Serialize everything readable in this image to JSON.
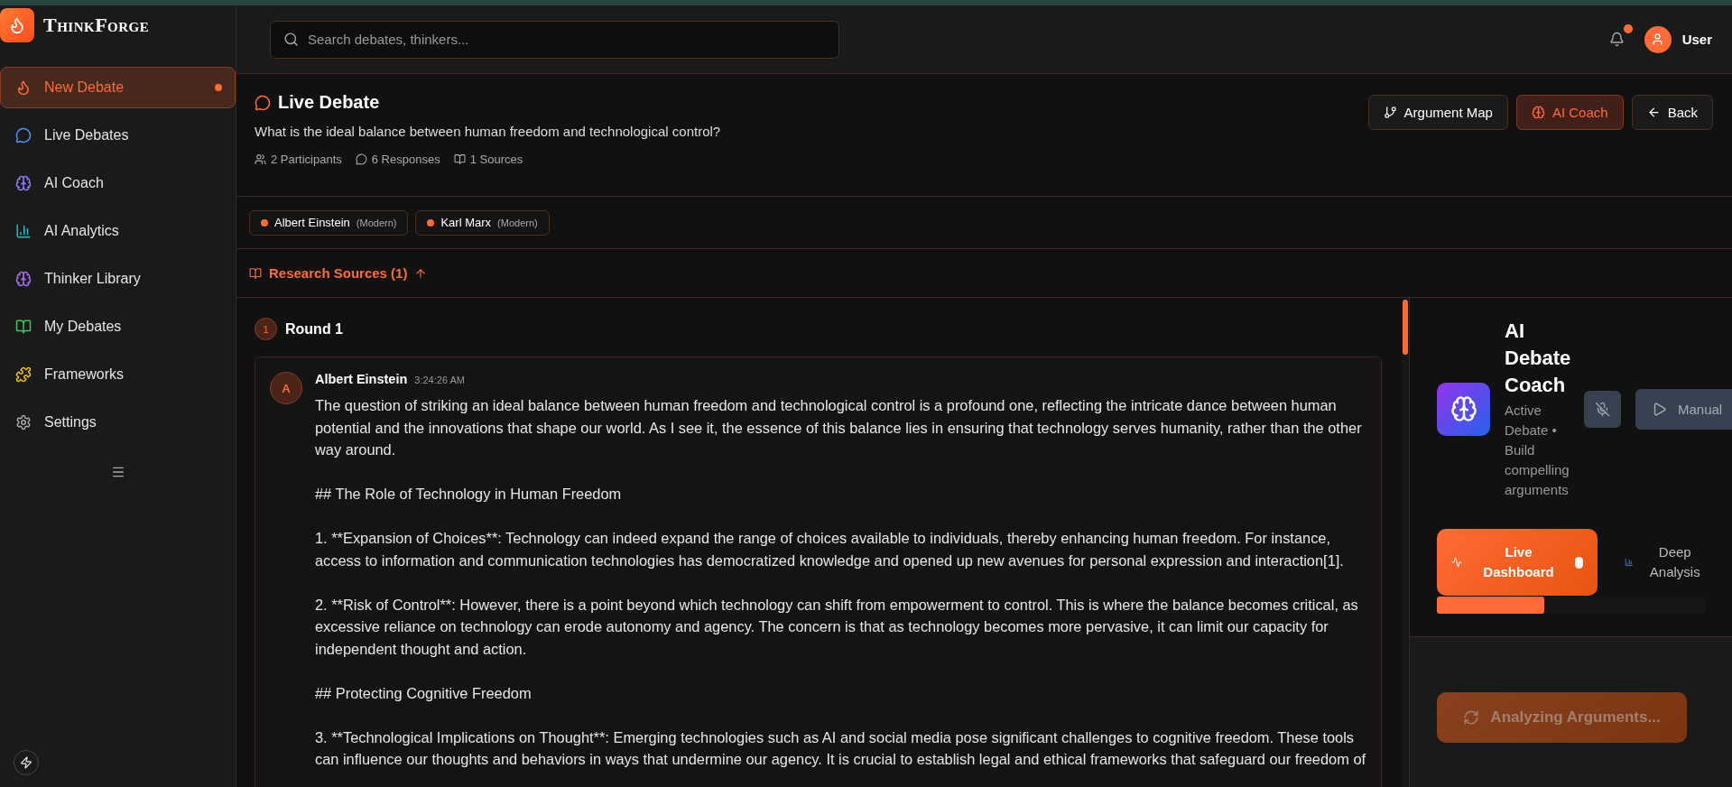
{
  "app": {
    "name": "ThinkForge"
  },
  "sidebar": {
    "items": [
      {
        "label": "New Debate",
        "selected": true,
        "dot": true
      },
      {
        "label": "Live Debates",
        "selected": false,
        "dot": false
      },
      {
        "label": "AI Coach",
        "selected": false,
        "dot": false
      },
      {
        "label": "AI Analytics",
        "selected": false,
        "dot": false
      },
      {
        "label": "Thinker Library",
        "selected": false,
        "dot": false
      },
      {
        "label": "My Debates",
        "selected": false,
        "dot": false
      },
      {
        "label": "Frameworks",
        "selected": false,
        "dot": false
      },
      {
        "label": "Settings",
        "selected": false,
        "dot": false
      }
    ]
  },
  "header": {
    "search": {
      "placeholder": "Search debates, thinkers..."
    },
    "notifications": {
      "unread": true
    },
    "user": {
      "name": "User"
    }
  },
  "debate": {
    "title": "Live Debate",
    "question": "What is the ideal balance between human freedom and technological control?",
    "meta": [
      "2 Participants",
      "6 Responses",
      "1 Sources"
    ],
    "actions": [
      {
        "label": "Argument Map",
        "selected": false
      },
      {
        "label": "AI Coach",
        "selected": true
      },
      {
        "label": "Back",
        "selected": false
      }
    ],
    "participants": [
      {
        "name": "Albert Einstein",
        "era": "(Modern)",
        "color": "#ff6b35"
      },
      {
        "name": "Karl Marx",
        "era": "(Modern)",
        "color": "#ff6b35"
      }
    ],
    "sources": {
      "label": "Research Sources (1)"
    }
  },
  "rounds": [
    {
      "number": "1",
      "title": "Round 1",
      "messages": [
        {
          "avatar": "A",
          "author": "Albert Einstein",
          "time": "3:24:26 AM",
          "paragraphs": [
            "The question of striking an ideal balance between human freedom and technological control is a profound one, reflecting the intricate dance between human potential and the innovations that shape our world. As I see it, the essence of this balance lies in ensuring that technology serves humanity, rather than the other way around.",
            "## The Role of Technology in Human Freedom",
            "1. **Expansion of Choices**: Technology can indeed expand the range of choices available to individuals, thereby enhancing human freedom. For instance, access to information and communication technologies has democratized knowledge and opened up new avenues for personal expression and interaction[1].",
            "2. **Risk of Control**: However, there is a point beyond which technology can shift from empowerment to control. This is where the balance becomes critical, as excessive reliance on technology can erode autonomy and agency. The concern is that as technology becomes more pervasive, it can limit our capacity for independent thought and action.",
            "## Protecting Cognitive Freedom",
            "3. **Technological Implications on Thought**: Emerging technologies such as AI and social media pose significant challenges to cognitive freedom. These tools can influence our thoughts and behaviors in ways that undermine our agency. It is crucial to establish legal and ethical frameworks that safeguard our freedom of"
          ]
        }
      ]
    }
  ],
  "coach": {
    "title": "AI Debate Coach",
    "subtitle": "Active Debate • Build compelling arguments",
    "mic_muted": true,
    "manual": {
      "label": "Manual"
    },
    "tabs": [
      {
        "label": "Live Dashboard",
        "selected": true
      },
      {
        "label": "Deep Analysis",
        "selected": false
      }
    ],
    "progress": {
      "level": 0.4
    },
    "action": {
      "label": "Analyzing Arguments...",
      "disabled": true
    }
  }
}
